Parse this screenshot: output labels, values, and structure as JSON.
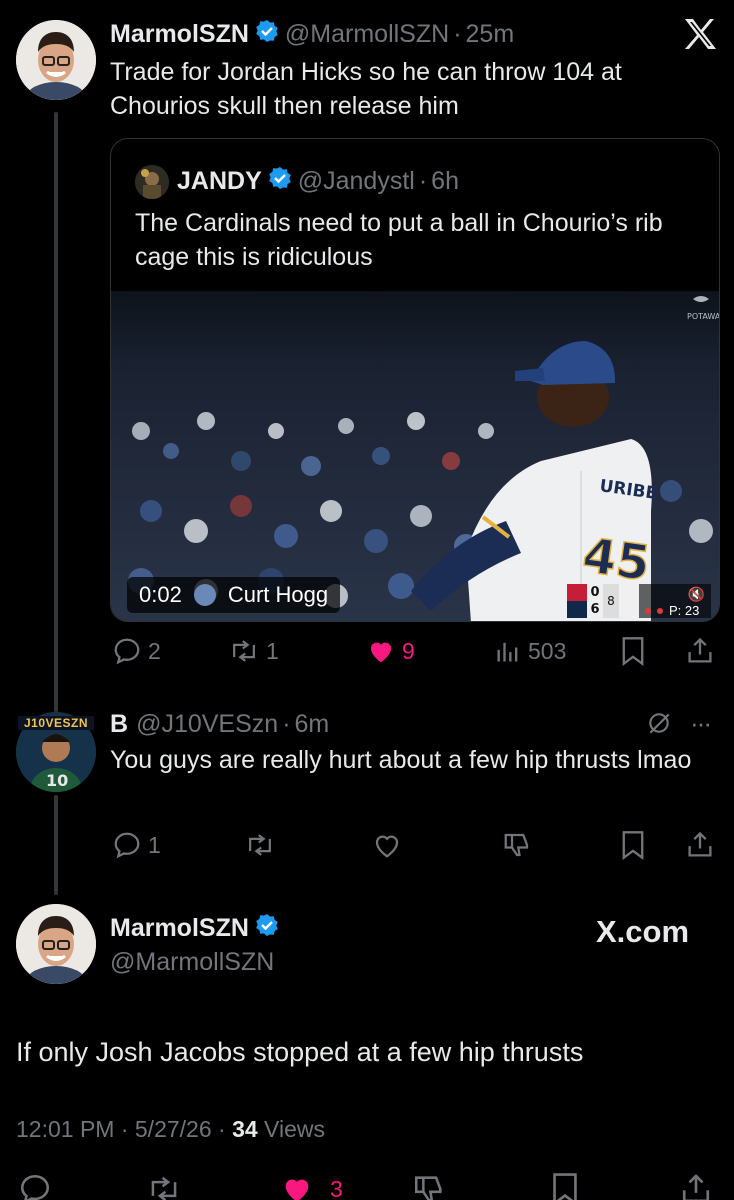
{
  "main_tweet": {
    "display_name": "MarmolSZN",
    "handle": "@MarmollSZN",
    "time": "25m",
    "text": "Trade for Jordan Hicks so he can throw 104 at Chourios skull then release him",
    "quote": {
      "display_name": "JANDY",
      "handle": "@Jandystl",
      "time": "6h",
      "text": "The Cardinals need to put a ball in Chourio’s rib cage this is ridiculous",
      "video": {
        "timestamp": "0:02",
        "credit": "Curt Hogg",
        "sponsor": "POTAWATOMI",
        "player_name": "URIBE",
        "player_number": "45",
        "score_away": "0",
        "score_home": "6",
        "inning": "8",
        "pitch_count": "P: 23"
      }
    },
    "replies": "2",
    "reposts": "1",
    "likes": "9",
    "views": "503"
  },
  "reply_tweet": {
    "avatar_text": "J10VESZN",
    "display_name": "B",
    "handle": "@J10VESzn",
    "time": "6m",
    "text": "You guys are really hurt about a few hip thrusts lmao",
    "replies": "1"
  },
  "focused_tweet": {
    "display_name": "MarmolSZN",
    "handle": "@MarmollSZN",
    "watermark": "X.com",
    "text": "If only Josh Jacobs stopped at a few hip thrusts",
    "timestamp": "12:01 PM · 5/27/26 · ",
    "views_count": "34",
    "views_label": " Views",
    "likes": "3"
  },
  "colors": {
    "background": "#000000",
    "primary_text": "#e7e9ea",
    "secondary_text": "#71767b",
    "verified_blue": "#1d9bf0",
    "like_pink": "#f91880",
    "border": "#2f3336"
  }
}
